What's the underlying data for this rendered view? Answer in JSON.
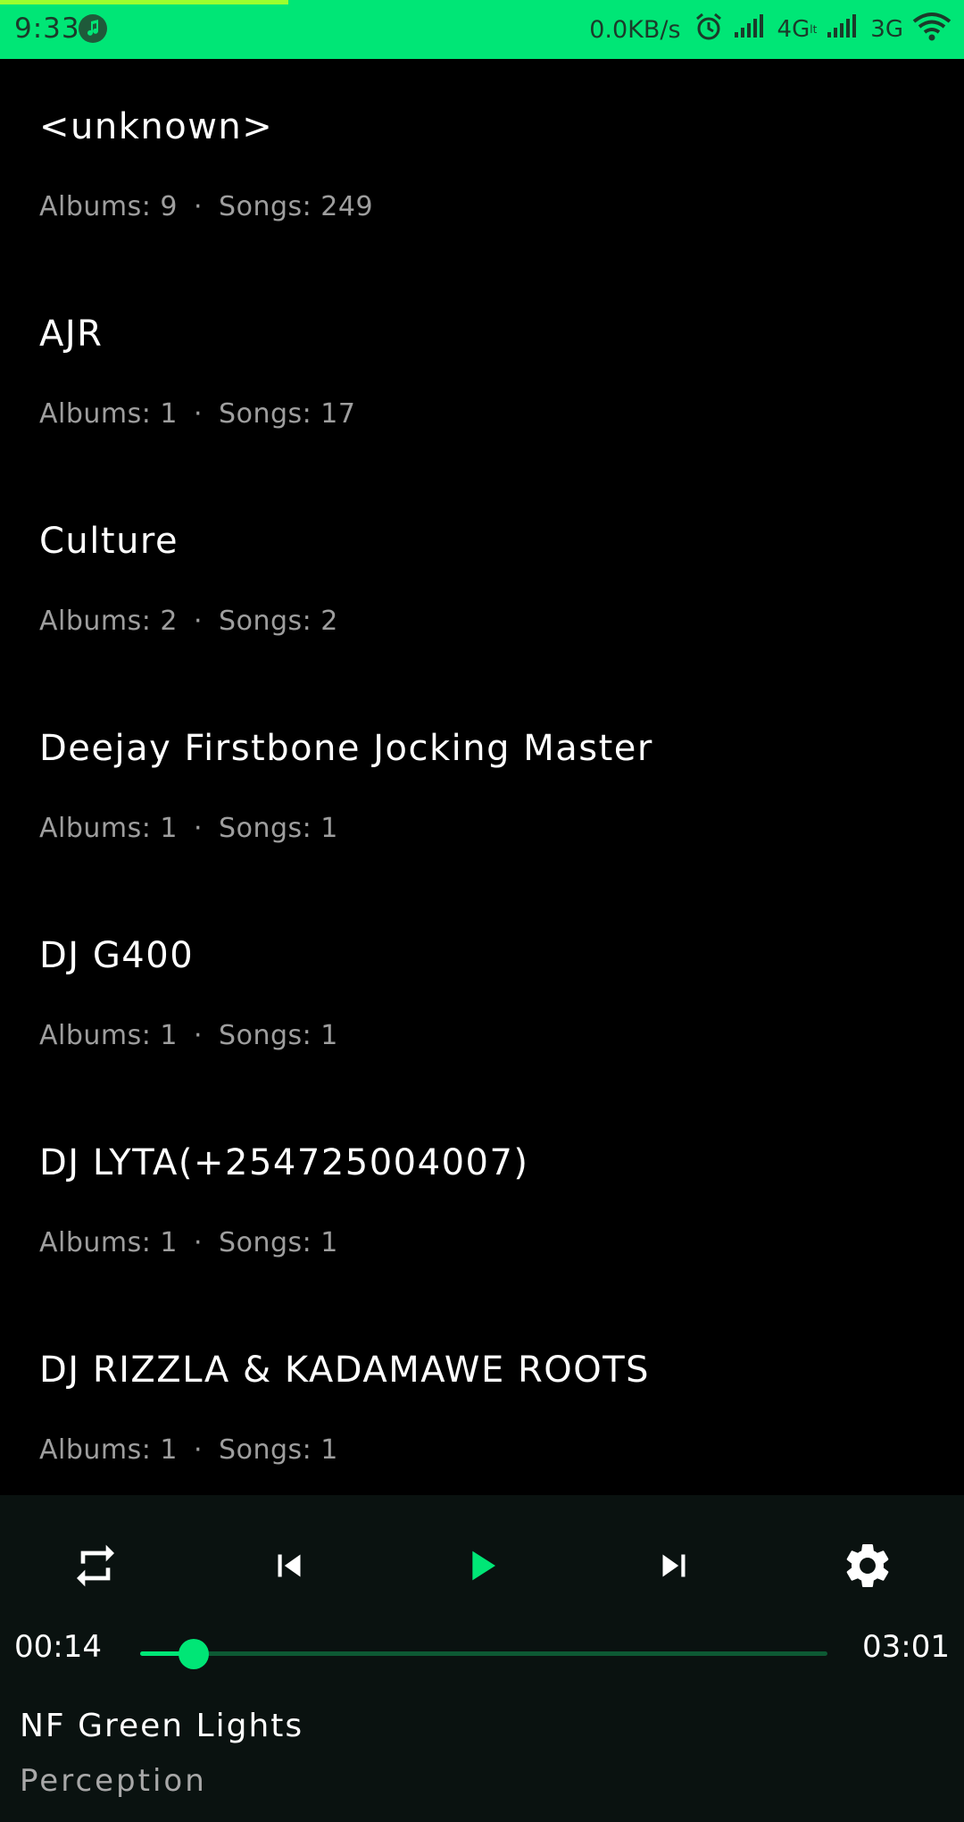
{
  "status_bar": {
    "time": "9:33",
    "net_speed": "0.0KB/s",
    "network1": "4G",
    "network1_suffix": "lt",
    "network2": "3G",
    "icons": [
      "music-note-icon",
      "alarm-icon",
      "signal-icon",
      "wifi-icon"
    ],
    "accent": "#00E676"
  },
  "artists": [
    {
      "name": "<unknown>",
      "albums_label": "Albums: 9",
      "songs_label": "Songs: 249"
    },
    {
      "name": "AJR",
      "albums_label": "Albums: 1",
      "songs_label": "Songs: 17"
    },
    {
      "name": "Culture",
      "albums_label": "Albums: 2",
      "songs_label": "Songs: 2"
    },
    {
      "name": "Deejay Firstbone Jocking Master",
      "albums_label": "Albums: 1",
      "songs_label": "Songs: 1"
    },
    {
      "name": "DJ G400",
      "albums_label": "Albums: 1",
      "songs_label": "Songs: 1"
    },
    {
      "name": "DJ LYTA(+254725004007)",
      "albums_label": "Albums: 1",
      "songs_label": "Songs: 1"
    },
    {
      "name": "DJ RIZZLA &  KADAMAWE ROOTS",
      "albums_label": "Albums: 1",
      "songs_label": "Songs: 1"
    }
  ],
  "separator": "·",
  "player": {
    "current_time": "00:14",
    "total_time": "03:01",
    "progress": 0.0773,
    "song_title": "NF Green Lights",
    "album": "Perception",
    "controls": [
      "repeat-icon",
      "previous-icon",
      "play-icon",
      "next-icon",
      "settings-icon"
    ],
    "accent": "#00E676",
    "background": "#0a1210"
  }
}
